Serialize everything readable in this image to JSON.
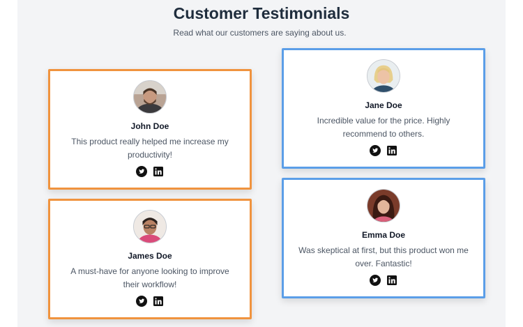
{
  "header": {
    "title": "Customer Testimonials",
    "subtitle": "Read what our customers are saying about us."
  },
  "testimonials": [
    {
      "name": "John Doe",
      "quote": "This product really helped me increase my productivity!",
      "accent": "#f0933e",
      "avatar": "avatar-john"
    },
    {
      "name": "James Doe",
      "quote": "A must-have for anyone looking to improve their workflow!",
      "accent": "#f0933e",
      "avatar": "avatar-james"
    },
    {
      "name": "Jane Doe",
      "quote": "Incredible value for the price. Highly recommend to others.",
      "accent": "#5b9ee8",
      "avatar": "avatar-jane"
    },
    {
      "name": "Emma Doe",
      "quote": "Was skeptical at first, but this product won me over. Fantastic!",
      "accent": "#5b9ee8",
      "avatar": "avatar-emma"
    }
  ],
  "social_icons": [
    "twitter-icon",
    "linkedin-icon"
  ],
  "colors": {
    "section_bg": "#f3f4f6",
    "orange_border": "#f0933e",
    "blue_border": "#5b9ee8",
    "title": "#1f2d3d"
  }
}
